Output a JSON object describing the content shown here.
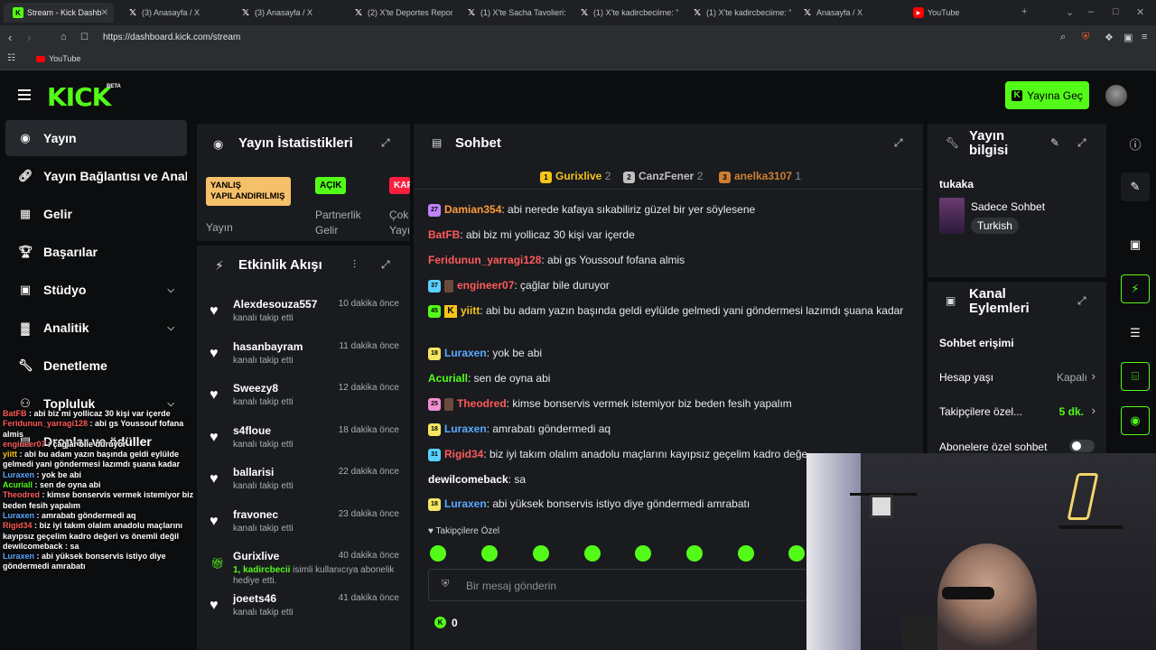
{
  "browser": {
    "tabs": [
      {
        "label": "Stream - Kick Dashb",
        "icon": "kick-icon"
      },
      {
        "label": "(3) Anasayfa / X",
        "icon": "x-icon"
      },
      {
        "label": "(3) Anasayfa / X",
        "icon": "x-icon"
      },
      {
        "label": "(2) X'te Deportes Reports",
        "icon": "x-icon"
      },
      {
        "label": "(1) X'te Sacha Tavolieri: \"",
        "icon": "x-icon"
      },
      {
        "label": "(1) X'te kadircbeciime: \"htt",
        "icon": "x-icon"
      },
      {
        "label": "(1) X'te kadircbeciime: \"htt",
        "icon": "x-icon"
      },
      {
        "label": "Anasayfa / X",
        "icon": "x-icon"
      },
      {
        "label": "YouTube",
        "icon": "youtube-icon"
      }
    ],
    "url": "https://dashboard.kick.com/stream",
    "bookmark": "YouTube"
  },
  "header": {
    "logo": "KICK",
    "beta": "BETA",
    "go_live": "Yayına Geç"
  },
  "sidebar": {
    "items": [
      {
        "label": "Yayın"
      },
      {
        "label": "Yayın Bağlantısı ve Anahtarı"
      },
      {
        "label": "Gelir"
      },
      {
        "label": "Başarılar"
      },
      {
        "label": "Stüdyo"
      },
      {
        "label": "Analitik"
      },
      {
        "label": "Denetleme"
      },
      {
        "label": "Topluluk"
      },
      {
        "label": "Droplar ve ödüller"
      }
    ]
  },
  "overlay_chat": [
    {
      "user": "BatFB",
      "color": "#ff5a5a",
      "text": "abi biz mi yollicaz 30 kişi var içerde"
    },
    {
      "user": "Feridunun_yarragi128",
      "color": "#ff5a5a",
      "text": "abi gs Youssouf fofana almis"
    },
    {
      "user": "engineer07",
      "color": "#ff5a5a",
      "text": "çağlar bile duruyor"
    },
    {
      "user": "yiitt",
      "color": "#f5c518",
      "text": "abi bu adam yazın başında geldi eylülde gelmedi yani göndermesi lazımdı şuana kadar"
    },
    {
      "user": "Luraxen",
      "color": "#5aa9ff",
      "text": "yok be abi"
    },
    {
      "user": "Acuriall",
      "color": "#53fc18",
      "text": "sen de oyna abi"
    },
    {
      "user": "Theodred",
      "color": "#ff5a5a",
      "text": "kimse bonservis vermek istemiyor biz beden fesih yapalım"
    },
    {
      "user": "Luraxen",
      "color": "#5aa9ff",
      "text": "amrabatı göndermedi aq"
    },
    {
      "user": "Rigid34",
      "color": "#ff5a5a",
      "text": "biz iyi takım olalım anadolu maçlarını kayıpsız geçelim kadro değeri vs önemli değil"
    },
    {
      "user": "dewilcomeback",
      "color": "#ffffff",
      "text": "sa"
    },
    {
      "user": "Luraxen",
      "color": "#5aa9ff",
      "text": "abi yüksek bonservis istiyo diye göndermedi amrabatı"
    }
  ],
  "stats_panel": {
    "title": "Yayın İstatistikleri",
    "badges": [
      {
        "text": "YANLIŞ YAPILANDIRILMIŞ",
        "label": "Yayın"
      },
      {
        "text": "AÇIK",
        "label": "Partnerlik Gelir"
      },
      {
        "text": "KAF",
        "label": "Çok Yayı"
      }
    ]
  },
  "activity_panel": {
    "title": "Etkinlik Akışı",
    "items": [
      {
        "user": "Alexdesouza557",
        "desc": "kanalı takip etti",
        "time": "10 dakika önce",
        "icon": "heart-icon"
      },
      {
        "user": "hasanbayram",
        "desc": "kanalı takip etti",
        "time": "11 dakika önce",
        "icon": "heart-icon"
      },
      {
        "user": "Sweezy8",
        "desc": "kanalı takip etti",
        "time": "12 dakika önce",
        "icon": "heart-icon"
      },
      {
        "user": "s4floue",
        "desc": "kanalı takip etti",
        "time": "18 dakika önce",
        "icon": "heart-icon"
      },
      {
        "user": "ballarisi",
        "desc": "kanalı takip etti",
        "time": "22 dakika önce",
        "icon": "heart-icon"
      },
      {
        "user": "fravonec",
        "desc": "kanalı takip etti",
        "time": "23 dakika önce",
        "icon": "heart-icon"
      },
      {
        "user": "Gurixlive",
        "desc_hl": "1, kadircbecii",
        "desc": " isimli kullanıcıya abonelik hediye etti.",
        "time": "40 dakika önce",
        "icon": "gift-icon"
      },
      {
        "user": "joeets46",
        "desc": "kanalı takip etti",
        "time": "41 dakika önce",
        "icon": "heart-icon"
      }
    ]
  },
  "chat_panel": {
    "title": "Sohbet",
    "top_gifters": [
      {
        "rank": "1",
        "name": "Gurixlive",
        "count": "2",
        "color": "#f5c518"
      },
      {
        "rank": "2",
        "name": "CanzFener",
        "count": "2",
        "color": "#c0c0c0"
      },
      {
        "rank": "3",
        "name": "anelka3107",
        "count": "1",
        "color": "#cd7f32"
      }
    ],
    "messages": [
      {
        "level": "27",
        "level_color": "#c084fc",
        "user": "Damian354",
        "color": "#ff9b3d",
        "text": ": abi nerede kafaya sıkabiliriz güzel bir yer söylesene"
      },
      {
        "user": "BatFB",
        "color": "#ff5a5a",
        "text": ": abi biz mi yollicaz 30 kişi var içerde"
      },
      {
        "user": "Feridunun_yarragi128",
        "color": "#ff5a5a",
        "text": ": abi gs Youssouf fofana almis"
      },
      {
        "level": "37",
        "level_color": "#5ad1ff",
        "avatar": true,
        "user": "engineer07",
        "color": "#ff5a5a",
        "text": ": çağlar bile duruyor"
      },
      {
        "level": "45",
        "level_color": "#53fc18",
        "kbadge": "K",
        "user": "yiitt",
        "color": "#f5c518",
        "text": ": abi bu adam yazın başında geldi eylülde gelmedi yani göndermesi lazımdı şuana kadar"
      },
      {
        "level": "18",
        "level_color": "#f5e663",
        "user": "Luraxen",
        "color": "#5aa9ff",
        "text": ": yok be abi"
      },
      {
        "user": "Acuriall",
        "color": "#53fc18",
        "text": ": sen de oyna abi"
      },
      {
        "level": "25",
        "level_color": "#f28fd0",
        "avatar": true,
        "user": "Theodred",
        "color": "#ff5a5a",
        "text": ": kimse bonservis vermek istemiyor biz beden fesih yapalım"
      },
      {
        "level": "18",
        "level_color": "#f5e663",
        "user": "Luraxen",
        "color": "#5aa9ff",
        "text": ": amrabatı göndermedi aq"
      },
      {
        "level": "31",
        "level_color": "#5ad1ff",
        "user": "Rigid34",
        "color": "#ff5a5a",
        "text": ": biz iyi takım olalım anadolu maçlarını kayıpsız geçelim kadro değeri vs önemli değil"
      },
      {
        "user": "dewilcomeback",
        "color": "#ffffff",
        "text": ": sa"
      },
      {
        "level": "18",
        "level_color": "#f5e663",
        "user": "Luraxen",
        "color": "#5aa9ff",
        "text": ": abi yüksek bonservis istiyo diye göndermedi amrabatı"
      }
    ],
    "followers_only": "Takipçilere Özel",
    "input_placeholder": "Bir mesaj gönderin",
    "points": "0"
  },
  "info_panel": {
    "title_line1": "Yayın",
    "title_line2": "bilgisi",
    "stream_title": "tukaka",
    "category": "Sadece Sohbet",
    "tag": "Turkish"
  },
  "actions_panel": {
    "title_line1": "Kanal",
    "title_line2": "Eylemleri",
    "section": "Sohbet erişimi",
    "rows": [
      {
        "label": "Hesap yaşı",
        "value": "Kapalı"
      },
      {
        "label": "Takipçilere özel...",
        "value": "5 dk."
      },
      {
        "label": "Abonelere özel sohbet",
        "value": ""
      }
    ]
  },
  "colors": {
    "accent": "#53fc18",
    "panel": "#191b1f",
    "bg": "#0b0d0f"
  }
}
